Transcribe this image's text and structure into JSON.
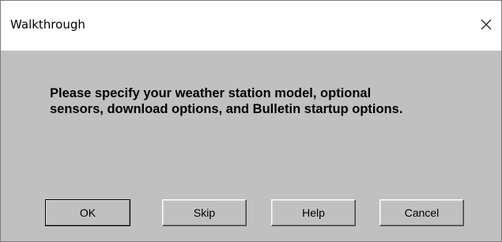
{
  "window": {
    "title": "Walkthrough",
    "close_icon": "close-icon"
  },
  "message": "Please specify your weather station model, optional\nsensors, download options, and Bulletin startup options.",
  "buttons": {
    "ok": "OK",
    "skip": "Skip",
    "help": "Help",
    "cancel": "Cancel"
  },
  "colors": {
    "dialog_background": "#c0c0c0",
    "titlebar_background": "#ffffff"
  }
}
